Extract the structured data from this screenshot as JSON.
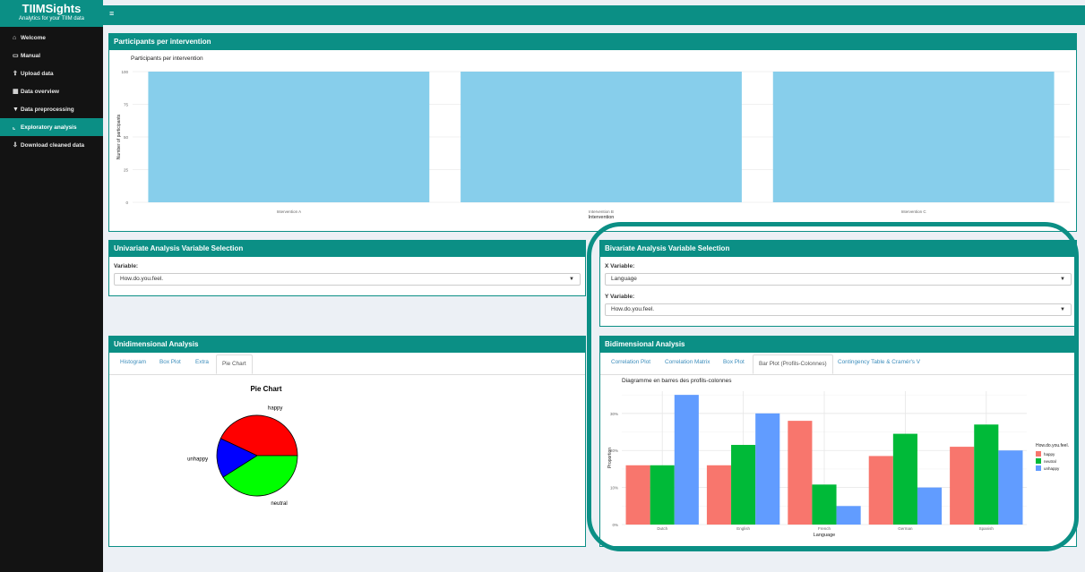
{
  "app": {
    "title": "TIIMSights",
    "subtitle": "Analytics for your TIIM data"
  },
  "sidebar": {
    "items": [
      {
        "label": "Welcome",
        "icon": "home-icon",
        "glyph": "⌂"
      },
      {
        "label": "Manual",
        "icon": "clipboard-icon",
        "glyph": "▭"
      },
      {
        "label": "Upload data",
        "icon": "upload-icon",
        "glyph": "⇪"
      },
      {
        "label": "Data overview",
        "icon": "table-icon",
        "glyph": "▦"
      },
      {
        "label": "Data preprocessing",
        "icon": "filter-icon",
        "glyph": "▼"
      },
      {
        "label": "Exploratory analysis",
        "icon": "line-chart-icon",
        "glyph": "⌞"
      },
      {
        "label": "Download cleaned data",
        "icon": "download-icon",
        "glyph": "⇩"
      }
    ],
    "active": 5
  },
  "topbar": {
    "menu_glyph": "≡"
  },
  "participants": {
    "header": "Participants per intervention"
  },
  "univariate": {
    "header": "Univariate Analysis Variable Selection",
    "variable_label": "Variable:",
    "variable_value": "How.do.you.feel."
  },
  "bivariate": {
    "header": "Bivariate Analysis Variable Selection",
    "x_label": "X Variable:",
    "x_value": "Language",
    "y_label": "Y Variable:",
    "y_value": "How.do.you.feel."
  },
  "unidim": {
    "header": "Unidimensional Analysis",
    "tabs": [
      "Histogram",
      "Box Plot",
      "Extra",
      "Pie Chart"
    ],
    "active_tab": 3
  },
  "bidim": {
    "header": "Bidimensional Analysis",
    "tabs": [
      "Correlation Plot",
      "Correlation Matrix",
      "Box Plot",
      "Bar Plot (Profils-Colonnes)",
      "Contingency Table & Cramér's V"
    ],
    "active_tab": 3
  },
  "chart_data": [
    {
      "type": "bar",
      "title": "Participants per intervention",
      "categories": [
        "Intervention A",
        "Intervention B",
        "Intervention C"
      ],
      "values": [
        100,
        100,
        100
      ],
      "xlabel": "Intervention",
      "ylabel": "Number of participants",
      "ylim": [
        0,
        100
      ],
      "yticks": [
        0,
        25,
        50,
        75,
        100
      ],
      "grid": true,
      "color": "#87ceeb"
    },
    {
      "type": "pie",
      "title": "Pie Chart",
      "labels": [
        "happy",
        "unhappy",
        "neutral"
      ],
      "values": [
        43,
        16,
        41
      ],
      "colors": [
        "#ff0000",
        "#0000ff",
        "#00ff00"
      ]
    },
    {
      "type": "bar",
      "title": "Diagramme en barres des profils-colonnes",
      "categories": [
        "Dutch",
        "English",
        "French",
        "German",
        "Spanish"
      ],
      "series": [
        {
          "name": "happy",
          "values": [
            16,
            16,
            28,
            18.5,
            21
          ],
          "color": "#f8766d"
        },
        {
          "name": "neutral",
          "values": [
            16,
            21.5,
            10.8,
            24.5,
            27
          ],
          "color": "#00ba38"
        },
        {
          "name": "unhappy",
          "values": [
            35,
            30,
            5,
            10,
            20
          ],
          "color": "#619cff"
        }
      ],
      "xlabel": "Language",
      "ylabel": "Proportion",
      "ylim": [
        0,
        36
      ],
      "yticks": [
        0,
        10,
        20,
        30
      ],
      "ytick_labels": [
        "0%",
        "10%",
        "20%",
        "30%"
      ],
      "legend_title": "How.do.you.feel.",
      "legend": "right",
      "grid": true
    }
  ]
}
